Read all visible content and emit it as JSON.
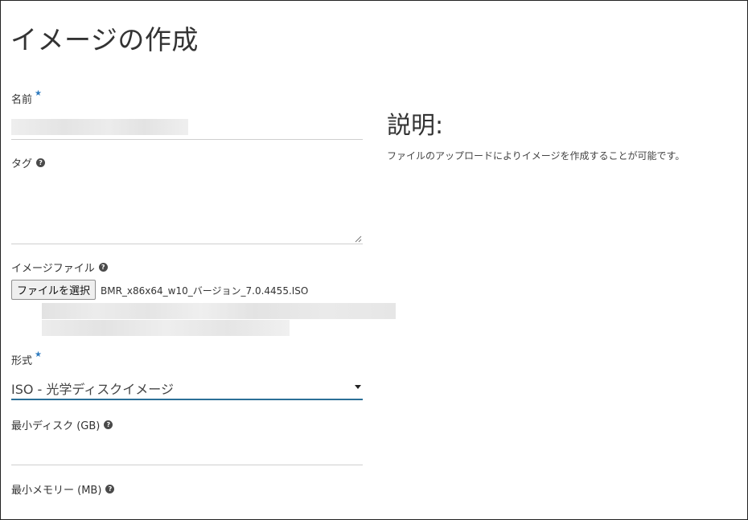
{
  "page": {
    "title": "イメージの作成"
  },
  "form": {
    "name": {
      "label": "名前",
      "required_mark": "★",
      "value": ""
    },
    "tags": {
      "label": "タグ",
      "help_icon": "question-circle-icon",
      "value": ""
    },
    "image_file": {
      "label": "イメージファイル",
      "help_icon": "question-circle-icon",
      "button_label": "ファイルを選択",
      "file_name": "BMR_x86x64_w10_バージョン_7.0.4455.ISO"
    },
    "format": {
      "label": "形式",
      "required_mark": "★",
      "selected": "ISO - 光学ディスクイメージ",
      "caret_icon": "caret-down-icon"
    },
    "min_disk": {
      "label": "最小ディスク (GB)",
      "help_icon": "question-circle-icon",
      "value": ""
    },
    "min_memory": {
      "label": "最小メモリー (MB)",
      "help_icon": "question-circle-icon"
    }
  },
  "description": {
    "heading": "説明:",
    "text": "ファイルのアップロードによりイメージを作成することが可能です。"
  },
  "colors": {
    "required_star": "#2f7bbf",
    "select_underline": "#2b6f97",
    "border": "#222222"
  }
}
